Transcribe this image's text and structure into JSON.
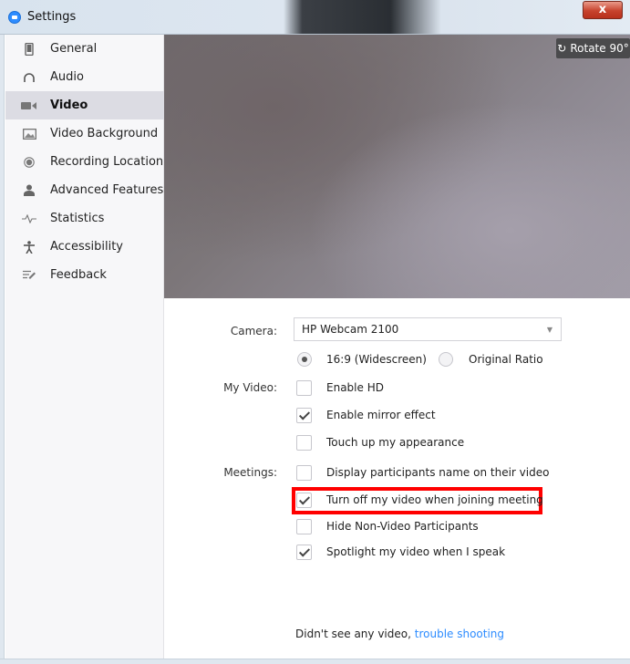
{
  "window": {
    "title": "Settings",
    "close_label": "x"
  },
  "sidebar": {
    "items": [
      {
        "label": "General",
        "icon": "phone-icon"
      },
      {
        "label": "Audio",
        "icon": "headphones-icon"
      },
      {
        "label": "Video",
        "icon": "video-camera-icon",
        "active": true
      },
      {
        "label": "Video Background",
        "icon": "image-icon"
      },
      {
        "label": "Recording Location",
        "icon": "record-icon"
      },
      {
        "label": "Advanced Features",
        "icon": "user-icon"
      },
      {
        "label": "Statistics",
        "icon": "pulse-icon"
      },
      {
        "label": "Accessibility",
        "icon": "accessibility-icon"
      },
      {
        "label": "Feedback",
        "icon": "feedback-icon"
      }
    ]
  },
  "preview": {
    "rotate_label": "Rotate 90°"
  },
  "camera": {
    "label": "Camera:",
    "selected": "HP Webcam 2100"
  },
  "ratio": {
    "widescreen": "16:9 (Widescreen)",
    "original": "Original Ratio",
    "selected": "16:9 (Widescreen)"
  },
  "my_video": {
    "label": "My Video:",
    "options": [
      {
        "label": "Enable HD",
        "checked": false
      },
      {
        "label": "Enable mirror effect",
        "checked": true
      },
      {
        "label": "Touch up my appearance",
        "checked": false
      }
    ]
  },
  "meetings": {
    "label": "Meetings:",
    "options": [
      {
        "label": "Display participants name on their video",
        "checked": false
      },
      {
        "label": "Turn off my video when joining meeting",
        "checked": true
      },
      {
        "label": "Hide Non-Video Participants",
        "checked": false
      },
      {
        "label": "Spotlight my video when I speak",
        "checked": true
      }
    ]
  },
  "footer": {
    "text": "Didn't see any video,",
    "link": "trouble shooting"
  },
  "colors": {
    "highlight": "#ff0000",
    "link": "#2d8cff"
  }
}
